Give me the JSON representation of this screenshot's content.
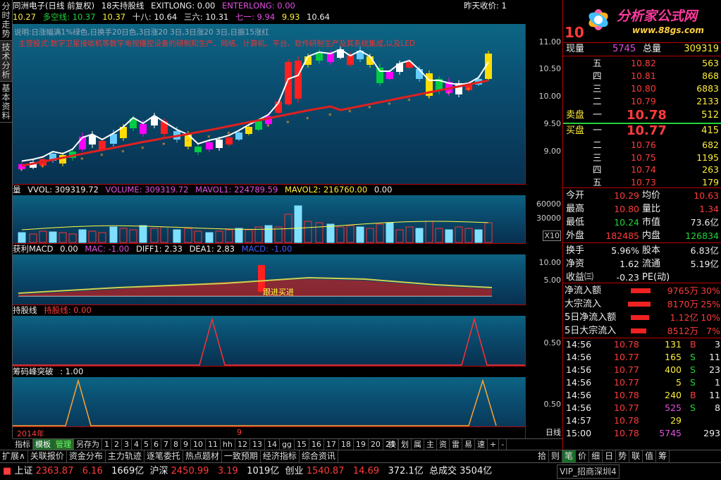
{
  "side_tabs": [
    "分时走势",
    "技术分析",
    "基本资料"
  ],
  "price_panel": {
    "title": "同洲电子(日线 前复权)",
    "ind_name": "18天持股线",
    "exitlong": "EXITLONG: 0.00",
    "enterlong": "ENTERLONG: 0.00",
    "prev_close": "昨天收价: 1",
    "row2": [
      "10.27",
      "多空线: 10.37",
      "10.37",
      "十八: 10.64",
      "三六: 10.31",
      "七一: 9.94",
      "9.93",
      "10.64"
    ],
    "notice1": "说明:日涨幅满1%绿色,日换手20日色,3日涨20 3日,3日涨20 3日,日振15涨红",
    "notice2": "主营投式:数字卫星接收机等数字电视播控设备的研制和生产、网络、计算机、平台、软件研制生产及其系统集成,以及LED",
    "annotations": [
      "持币",
      "持股",
      "买",
      "持币",
      "持股",
      "卖",
      "持股",
      "持币",
      "买",
      "8.61",
      "11.25",
      "持股",
      "卖",
      "买"
    ],
    "yticks": [
      "11.00",
      "10.50",
      "10.00",
      "9.50",
      "9.00"
    ]
  },
  "vol_panel": {
    "label": "量",
    "items": [
      "VVOL: 309319.72",
      "VOLUME: 309319.72",
      "MAVOL1: 224789.59",
      "MAVOL2: 216760.00",
      "0.00"
    ],
    "yticks": [
      "60000",
      "30000"
    ],
    "x10": "X10"
  },
  "macd_panel": {
    "label": "获利MACD",
    "items": [
      "0.00",
      "MAC: -1.00",
      "DIFF1: 2.33",
      "DEA1: 2.83",
      "MACD: -1.00"
    ],
    "yticks": [
      "10.00",
      "5.00"
    ],
    "note": "跟进买进"
  },
  "hold_panel": {
    "label": "持股线",
    "item": "持股线: 0.00",
    "yticks": [
      "0.50"
    ]
  },
  "chip_panel": {
    "label": "筹码峰突破",
    "item": ": 1.00",
    "yticks": [
      "0.50"
    ],
    "year": "2014年",
    "month": "9",
    "period": "日线"
  },
  "bottom_tabs": [
    "指标",
    "模板",
    "管理",
    "另存为",
    "1",
    "2",
    "3",
    "4",
    "5",
    "6",
    "7",
    "8",
    "9",
    "10",
    "11",
    "hh",
    "12",
    "13",
    "14",
    "gg",
    "15",
    "16",
    "17",
    "18",
    "19",
    "20",
    "21"
  ],
  "bottom_right": [
    "换",
    "划",
    "属",
    "主",
    "资",
    "雷",
    "易",
    "速",
    "+",
    "-"
  ],
  "func_tabs": [
    "扩展∧",
    "关联报价",
    "资金分布",
    "主力轨迹",
    "逐笔委托",
    "热点题材",
    "一致预期",
    "经济指标",
    "综合资讯"
  ],
  "func_right": [
    "拾",
    "则",
    "笔",
    "价",
    "细",
    "日",
    "势",
    "联",
    "值",
    "筹"
  ],
  "status": {
    "sh_label": "上证",
    "sh": "2363.87",
    "sh_chg": "6.16",
    "sh_amt": "1669亿",
    "sz_label": "沪深",
    "sz": "2450.99",
    "sz_chg": "3.19",
    "sz_amt": "1019亿",
    "cy_label": "创业",
    "cy": "1540.87",
    "cy_chg": "14.69",
    "cy_amt": "372.1亿",
    "tot_label": "总成交",
    "tot": "3504亿",
    "vip": "VIP_招商深圳4"
  },
  "right": {
    "logo": "分析家公式网",
    "url": "www.88gs.com",
    "code": "10",
    "now_label": "现量",
    "now_vol": "5745",
    "tot_label": "总量",
    "tot_vol": "309319",
    "asks": [
      {
        "n": "五",
        "p": "10.82",
        "v": "563"
      },
      {
        "n": "四",
        "p": "10.81",
        "v": "868"
      },
      {
        "n": "三",
        "p": "10.80",
        "v": "6883"
      },
      {
        "n": "二",
        "p": "10.79",
        "v": "2133"
      }
    ],
    "sell_label": "卖盘",
    "sell1_n": "一",
    "sell1_p": "10.78",
    "sell1_v": "512",
    "buy_label": "买盘",
    "buy1_n": "一",
    "buy1_p": "10.77",
    "buy1_v": "415",
    "bids": [
      {
        "n": "二",
        "p": "10.76",
        "v": "682"
      },
      {
        "n": "三",
        "p": "10.75",
        "v": "1195"
      },
      {
        "n": "四",
        "p": "10.74",
        "v": "263"
      },
      {
        "n": "五",
        "p": "10.73",
        "v": "179"
      }
    ],
    "stats": [
      [
        "今开",
        "10.29",
        "均价",
        "10.63"
      ],
      [
        "最高",
        "10.80",
        "量比",
        "1.34"
      ],
      [
        "最低",
        "10.24",
        "市值",
        "73.6亿"
      ],
      [
        "外盘",
        "182485",
        "内盘",
        "126834"
      ]
    ],
    "stats2": [
      [
        "换手",
        "5.96%",
        "股本",
        "6.83亿"
      ],
      [
        "净资",
        "1.62",
        "流通",
        "5.19亿"
      ],
      [
        "收益㈢",
        "-0.23",
        "PE(动)",
        ""
      ]
    ],
    "flows": [
      [
        "净流入额",
        "9765万",
        "30%"
      ],
      [
        "大宗流入",
        "8170万",
        "25%"
      ],
      [
        "5日净流入额",
        "1.12亿",
        "10%"
      ],
      [
        "5日大宗流入",
        "8512万",
        "7%"
      ]
    ],
    "ticks": [
      [
        "14:56",
        "10.78",
        "131",
        "B",
        "3"
      ],
      [
        "14:56",
        "10.77",
        "165",
        "S",
        "11"
      ],
      [
        "14:56",
        "10.77",
        "400",
        "S",
        "23"
      ],
      [
        "14:56",
        "10.77",
        "5",
        "S",
        "1"
      ],
      [
        "14:56",
        "10.78",
        "240",
        "B",
        "11"
      ],
      [
        "14:56",
        "10.77",
        "525",
        "S",
        "8"
      ],
      [
        "14:57",
        "10.78",
        "29",
        "",
        ""
      ],
      [
        "15:00",
        "10.78",
        "5745",
        "",
        "293"
      ]
    ]
  }
}
